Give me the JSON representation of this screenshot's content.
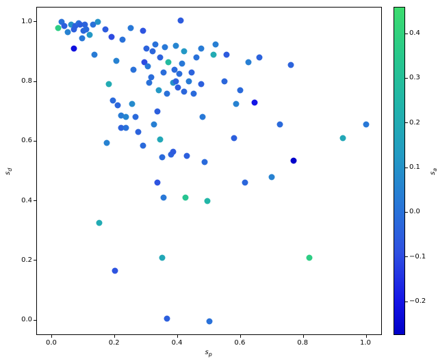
{
  "chart_data": {
    "type": "scatter",
    "xlabel": "sₚ",
    "ylabel": "s_d",
    "clabel": "sₐ",
    "xlim": [
      -0.05,
      1.05
    ],
    "ylim": [
      -0.05,
      1.05
    ],
    "clim": [
      -0.275,
      0.46
    ],
    "xticks": [
      0.0,
      0.2,
      0.4,
      0.6,
      0.8,
      1.0
    ],
    "yticks": [
      0.0,
      0.2,
      0.4,
      0.6,
      0.8,
      1.0
    ],
    "cticks": [
      -0.2,
      -0.1,
      0.0,
      0.1,
      0.2,
      0.3,
      0.4
    ],
    "points": [
      {
        "x": 0.02,
        "y": 0.98,
        "c": 0.38
      },
      {
        "x": 0.03,
        "y": 1.0,
        "c": 0.0
      },
      {
        "x": 0.04,
        "y": 0.985,
        "c": -0.05
      },
      {
        "x": 0.05,
        "y": 0.965,
        "c": 0.05
      },
      {
        "x": 0.06,
        "y": 0.99,
        "c": 0.1
      },
      {
        "x": 0.07,
        "y": 0.975,
        "c": -0.05
      },
      {
        "x": 0.07,
        "y": 0.91,
        "c": -0.22
      },
      {
        "x": 0.075,
        "y": 0.985,
        "c": -0.05
      },
      {
        "x": 0.085,
        "y": 0.995,
        "c": 0.0
      },
      {
        "x": 0.09,
        "y": 0.99,
        "c": -0.05
      },
      {
        "x": 0.095,
        "y": 0.945,
        "c": 0.02
      },
      {
        "x": 0.1,
        "y": 0.97,
        "c": -0.03
      },
      {
        "x": 0.105,
        "y": 0.99,
        "c": -0.04
      },
      {
        "x": 0.11,
        "y": 0.975,
        "c": -0.02
      },
      {
        "x": 0.12,
        "y": 0.955,
        "c": 0.12
      },
      {
        "x": 0.13,
        "y": 0.99,
        "c": 0.0
      },
      {
        "x": 0.135,
        "y": 0.89,
        "c": 0.03
      },
      {
        "x": 0.145,
        "y": 1.0,
        "c": 0.1
      },
      {
        "x": 0.15,
        "y": 0.325,
        "c": 0.2
      },
      {
        "x": 0.17,
        "y": 0.975,
        "c": -0.06
      },
      {
        "x": 0.175,
        "y": 0.595,
        "c": 0.05
      },
      {
        "x": 0.18,
        "y": 0.79,
        "c": 0.2
      },
      {
        "x": 0.19,
        "y": 0.95,
        "c": -0.1
      },
      {
        "x": 0.195,
        "y": 0.735,
        "c": -0.02
      },
      {
        "x": 0.2,
        "y": 0.165,
        "c": -0.08
      },
      {
        "x": 0.205,
        "y": 0.87,
        "c": 0.05
      },
      {
        "x": 0.21,
        "y": 0.72,
        "c": -0.03
      },
      {
        "x": 0.22,
        "y": 0.685,
        "c": 0.03
      },
      {
        "x": 0.22,
        "y": 0.645,
        "c": -0.04
      },
      {
        "x": 0.225,
        "y": 0.94,
        "c": 0.0
      },
      {
        "x": 0.235,
        "y": 0.68,
        "c": 0.06
      },
      {
        "x": 0.235,
        "y": 0.645,
        "c": 0.0
      },
      {
        "x": 0.25,
        "y": 0.98,
        "c": 0.02
      },
      {
        "x": 0.255,
        "y": 0.725,
        "c": 0.08
      },
      {
        "x": 0.26,
        "y": 0.84,
        "c": 0.0
      },
      {
        "x": 0.265,
        "y": 0.68,
        "c": -0.02
      },
      {
        "x": 0.275,
        "y": 0.63,
        "c": -0.04
      },
      {
        "x": 0.29,
        "y": 0.585,
        "c": -0.02
      },
      {
        "x": 0.29,
        "y": 0.97,
        "c": -0.08
      },
      {
        "x": 0.295,
        "y": 0.865,
        "c": -0.1
      },
      {
        "x": 0.3,
        "y": 0.91,
        "c": -0.04
      },
      {
        "x": 0.305,
        "y": 0.85,
        "c": 0.02
      },
      {
        "x": 0.31,
        "y": 0.795,
        "c": 0.0
      },
      {
        "x": 0.315,
        "y": 0.815,
        "c": -0.01
      },
      {
        "x": 0.32,
        "y": 0.9,
        "c": -0.03
      },
      {
        "x": 0.325,
        "y": 0.655,
        "c": 0.04
      },
      {
        "x": 0.33,
        "y": 0.925,
        "c": 0.0
      },
      {
        "x": 0.335,
        "y": 0.7,
        "c": -0.05
      },
      {
        "x": 0.335,
        "y": 0.46,
        "c": -0.08
      },
      {
        "x": 0.34,
        "y": 0.77,
        "c": 0.12
      },
      {
        "x": 0.345,
        "y": 0.88,
        "c": -0.04
      },
      {
        "x": 0.345,
        "y": 0.605,
        "c": 0.18
      },
      {
        "x": 0.35,
        "y": 0.545,
        "c": -0.02
      },
      {
        "x": 0.35,
        "y": 0.21,
        "c": 0.18
      },
      {
        "x": 0.355,
        "y": 0.83,
        "c": -0.01
      },
      {
        "x": 0.355,
        "y": 0.41,
        "c": 0.02
      },
      {
        "x": 0.36,
        "y": 0.915,
        "c": 0.02
      },
      {
        "x": 0.365,
        "y": 0.76,
        "c": 0.0
      },
      {
        "x": 0.365,
        "y": 0.005,
        "c": -0.05
      },
      {
        "x": 0.37,
        "y": 0.865,
        "c": 0.28
      },
      {
        "x": 0.38,
        "y": 0.555,
        "c": -0.04
      },
      {
        "x": 0.385,
        "y": 0.795,
        "c": 0.1
      },
      {
        "x": 0.385,
        "y": 0.565,
        "c": -0.06
      },
      {
        "x": 0.39,
        "y": 0.84,
        "c": -0.02
      },
      {
        "x": 0.395,
        "y": 0.8,
        "c": -0.04
      },
      {
        "x": 0.395,
        "y": 0.92,
        "c": 0.06
      },
      {
        "x": 0.4,
        "y": 0.78,
        "c": -0.05
      },
      {
        "x": 0.405,
        "y": 0.825,
        "c": -0.01
      },
      {
        "x": 0.41,
        "y": 1.005,
        "c": -0.06
      },
      {
        "x": 0.415,
        "y": 0.86,
        "c": 0.02
      },
      {
        "x": 0.42,
        "y": 0.9,
        "c": 0.12
      },
      {
        "x": 0.42,
        "y": 0.765,
        "c": -0.03
      },
      {
        "x": 0.425,
        "y": 0.41,
        "c": 0.33
      },
      {
        "x": 0.43,
        "y": 0.55,
        "c": -0.05
      },
      {
        "x": 0.435,
        "y": 0.8,
        "c": 0.03
      },
      {
        "x": 0.445,
        "y": 0.83,
        "c": -0.04
      },
      {
        "x": 0.45,
        "y": 0.76,
        "c": -0.02
      },
      {
        "x": 0.46,
        "y": 0.88,
        "c": 0.0
      },
      {
        "x": 0.475,
        "y": 0.79,
        "c": -0.05
      },
      {
        "x": 0.475,
        "y": 0.91,
        "c": 0.03
      },
      {
        "x": 0.48,
        "y": 0.68,
        "c": 0.02
      },
      {
        "x": 0.485,
        "y": 0.53,
        "c": -0.02
      },
      {
        "x": 0.495,
        "y": 0.4,
        "c": 0.25
      },
      {
        "x": 0.5,
        "y": -0.005,
        "c": 0.0
      },
      {
        "x": 0.515,
        "y": 0.89,
        "c": 0.2
      },
      {
        "x": 0.52,
        "y": 0.925,
        "c": 0.04
      },
      {
        "x": 0.55,
        "y": 0.8,
        "c": -0.03
      },
      {
        "x": 0.555,
        "y": 0.89,
        "c": -0.06
      },
      {
        "x": 0.58,
        "y": 0.61,
        "c": -0.05
      },
      {
        "x": 0.585,
        "y": 0.725,
        "c": 0.05
      },
      {
        "x": 0.6,
        "y": 0.77,
        "c": -0.02
      },
      {
        "x": 0.615,
        "y": 0.46,
        "c": -0.03
      },
      {
        "x": 0.625,
        "y": 0.865,
        "c": 0.04
      },
      {
        "x": 0.645,
        "y": 0.73,
        "c": -0.2
      },
      {
        "x": 0.66,
        "y": 0.88,
        "c": -0.04
      },
      {
        "x": 0.7,
        "y": 0.48,
        "c": 0.05
      },
      {
        "x": 0.725,
        "y": 0.655,
        "c": -0.02
      },
      {
        "x": 0.76,
        "y": 0.855,
        "c": -0.04
      },
      {
        "x": 0.77,
        "y": 0.535,
        "c": -0.27
      },
      {
        "x": 0.82,
        "y": 0.21,
        "c": 0.38
      },
      {
        "x": 0.925,
        "y": 0.61,
        "c": 0.18
      },
      {
        "x": 1.0,
        "y": 0.655,
        "c": 0.02
      }
    ]
  },
  "xlabel_text": "sₚ",
  "ylabel_html": "<span style=\"font-style:italic\">s</span><sub style=\"font-style:italic;font-size:8px\">d</sub>",
  "clabel_html": "<span style=\"font-style:italic\">s</span><sub style=\"font-style:italic;font-size:8px\">a</sub>",
  "xtick_labels": [
    "0.0",
    "0.2",
    "0.4",
    "0.6",
    "0.8",
    "1.0"
  ],
  "ytick_labels": [
    "0.0",
    "0.2",
    "0.4",
    "0.6",
    "0.8",
    "1.0"
  ],
  "ctick_labels": [
    "−0.2",
    "−0.1",
    "0.0",
    "0.1",
    "0.2",
    "0.3",
    "0.4"
  ]
}
